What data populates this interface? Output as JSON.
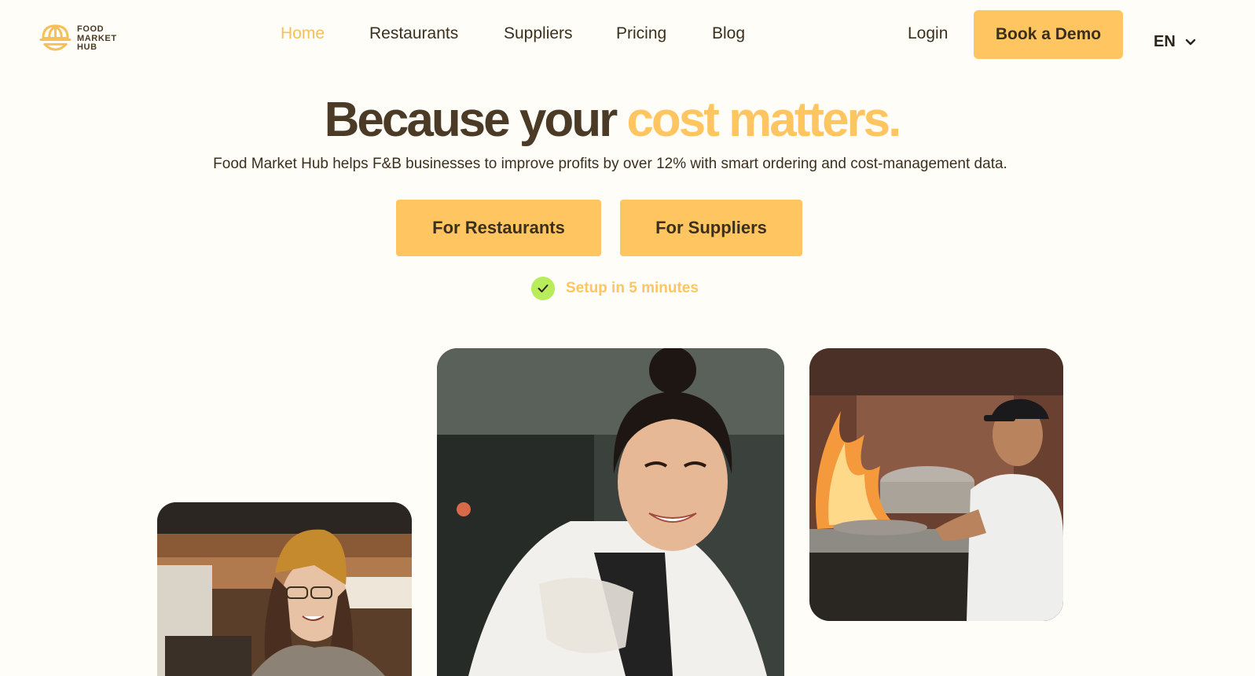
{
  "brand": {
    "logo_lines": [
      "FOOD",
      "MARKET",
      "HUB"
    ],
    "accent_color": "#ffc560",
    "text_color": "#3b2f1e",
    "check_color": "#b8ec5a"
  },
  "nav": {
    "items": [
      {
        "label": "Home",
        "active": true
      },
      {
        "label": "Restaurants",
        "active": false
      },
      {
        "label": "Suppliers",
        "active": false
      },
      {
        "label": "Pricing",
        "active": false
      },
      {
        "label": "Blog",
        "active": false
      }
    ],
    "login_label": "Login",
    "book_demo_label": "Book a Demo",
    "language": "EN"
  },
  "hero": {
    "headline_part1": "Because your ",
    "headline_accent": "cost matters.",
    "subline": "Food Market Hub helps F&B businesses to improve profits by over 12% with smart ordering and cost-management data.",
    "cta_restaurants": "For Restaurants",
    "cta_suppliers": "For Suppliers",
    "setup_note": "Setup in 5 minutes"
  },
  "icons": {
    "logo": "burger-dome-logo-icon",
    "language_dropdown": "chevron-down-icon",
    "setup_check": "check-circle-icon"
  }
}
